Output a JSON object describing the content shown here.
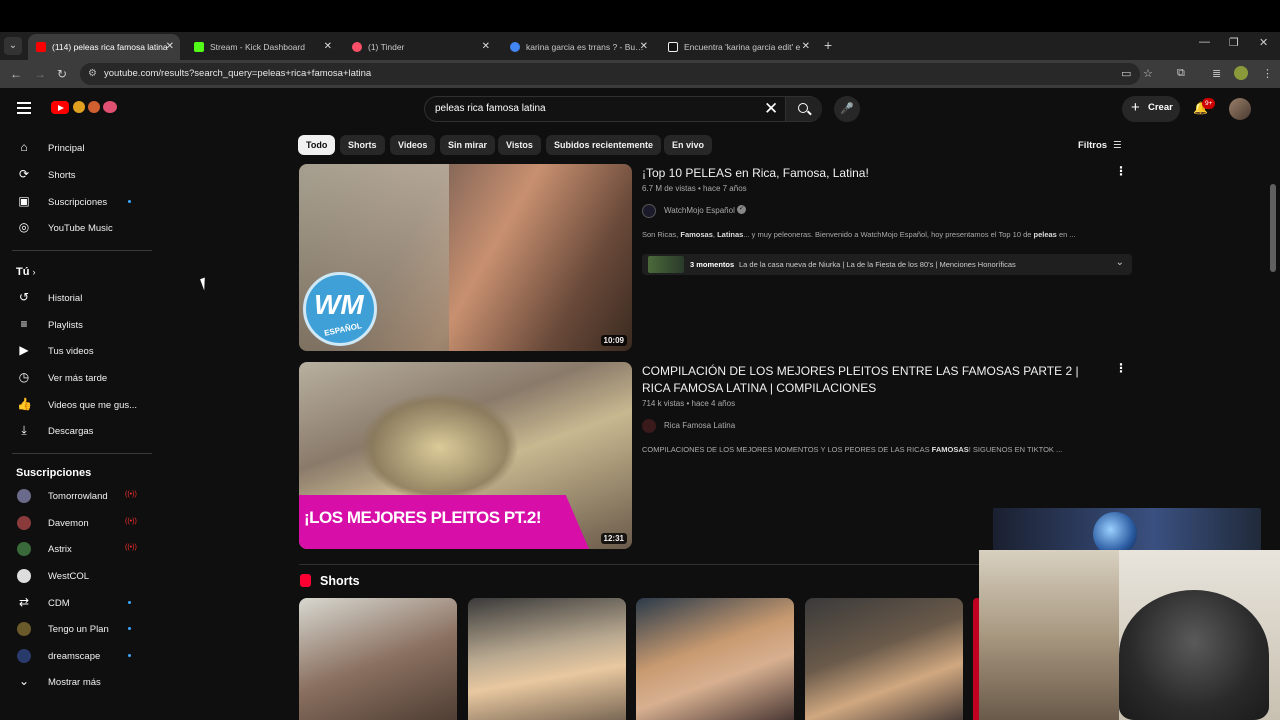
{
  "browser": {
    "tabs": [
      {
        "title": "(114) peleas rica famosa latina",
        "active": true,
        "favicon_color": "#ff0000"
      },
      {
        "title": "Stream - Kick Dashboard",
        "active": false,
        "favicon_color": "#53fc18"
      },
      {
        "title": "(1) Tinder",
        "active": false,
        "favicon_color": "#fd5068"
      },
      {
        "title": "karina garcia es trrans ? - Buscar",
        "active": false,
        "favicon_color": "#4285f4"
      },
      {
        "title": "Encuentra 'karina garcia edit' e",
        "active": false,
        "favicon_color": "#ffffff"
      }
    ],
    "new_tab": "+",
    "url": "youtube.com/results?search_query=peleas+rica+famosa+latina"
  },
  "header": {
    "search_query": "peleas rica famosa latina",
    "create_label": "Crear",
    "notifications_badge": "9+"
  },
  "sidebar": {
    "main": [
      {
        "label": "Principal",
        "icon": "home-icon",
        "glyph": "⌂"
      },
      {
        "label": "Shorts",
        "icon": "shorts-icon",
        "glyph": "⟳"
      },
      {
        "label": "Suscripciones",
        "icon": "subscriptions-icon",
        "glyph": "▣"
      },
      {
        "label": "YouTube Music",
        "icon": "music-icon",
        "glyph": "◎"
      }
    ],
    "you_heading": "Tú",
    "you": [
      {
        "label": "Historial",
        "icon": "history-icon",
        "glyph": "↺"
      },
      {
        "label": "Playlists",
        "icon": "playlists-icon",
        "glyph": "≡"
      },
      {
        "label": "Tus videos",
        "icon": "your-videos-icon",
        "glyph": "▶"
      },
      {
        "label": "Ver más tarde",
        "icon": "watch-later-icon",
        "glyph": "◷"
      },
      {
        "label": "Videos que me gus...",
        "icon": "liked-icon",
        "glyph": "👍"
      },
      {
        "label": "Descargas",
        "icon": "downloads-icon",
        "glyph": "⤓"
      }
    ],
    "subs_heading": "Suscripciones",
    "subs": [
      {
        "label": "Tomorrowland",
        "color": "#6a6a8a",
        "status": "live"
      },
      {
        "label": "Davemon",
        "color": "#8a3a3a",
        "status": "live"
      },
      {
        "label": "Astrix",
        "color": "#3a6a3a",
        "status": "live"
      },
      {
        "label": "WestCOL",
        "color": "#dddddd",
        "status": "none"
      },
      {
        "label": "CDM",
        "color": "#0f0f0f",
        "status": "dot"
      },
      {
        "label": "Tengo un Plan",
        "color": "#6a5a2a",
        "status": "dot"
      },
      {
        "label": "dreamscape",
        "color": "#2a3a6a",
        "status": "dot"
      }
    ],
    "show_more": "Mostrar más",
    "live_glyph": "((•))"
  },
  "chips": [
    "Todo",
    "Shorts",
    "Videos",
    "Sin mirar",
    "Vistos",
    "Subidos recientemente",
    "En vivo"
  ],
  "filters_label": "Filtros",
  "results": [
    {
      "title": "¡Top 10 PELEAS en Rica, Famosa, Latina!",
      "meta": "6.7 M de vistas • hace 7 años",
      "channel": "WatchMojo Español",
      "verified": true,
      "description_pre": "Son Ricas, ",
      "description_b1": "Famosas",
      "description_mid": ", ",
      "description_b2": "Latinas",
      "description_post": "... y muy peleoneras. Bienvenido a WatchMojo Español, hoy presentamos el Top 10 de ",
      "description_b3": "peleas",
      "description_end": " en ...",
      "duration": "10:09",
      "moments_count": "3 momentos",
      "moments_list": "La de la casa nueva de Niurka | La de la Fiesta de los 80's | Menciones Honoríficas",
      "badge_text": "WM",
      "badge_sub": "ESPAÑOL"
    },
    {
      "title": "COMPILACIÓN DE LOS MEJORES PLEITOS ENTRE LAS FAMOSAS PARTE 2 | RICA FAMOSA LATINA | COMPILACIONES",
      "meta": "714 k vistas • hace 4 años",
      "channel": "Rica Famosa Latina",
      "description_pre": "COMPILACIONES DE LOS MEJORES MOMENTOS Y LOS PEORES DE LAS RICAS ",
      "description_b1": "FAMOSAS",
      "description_post": "! SIGUENOS EN TIKTOK ...",
      "duration": "12:31",
      "overlay_text": "¡LOS MEJORES PLEITOS PT.2!"
    }
  ],
  "shorts_heading": "Shorts"
}
